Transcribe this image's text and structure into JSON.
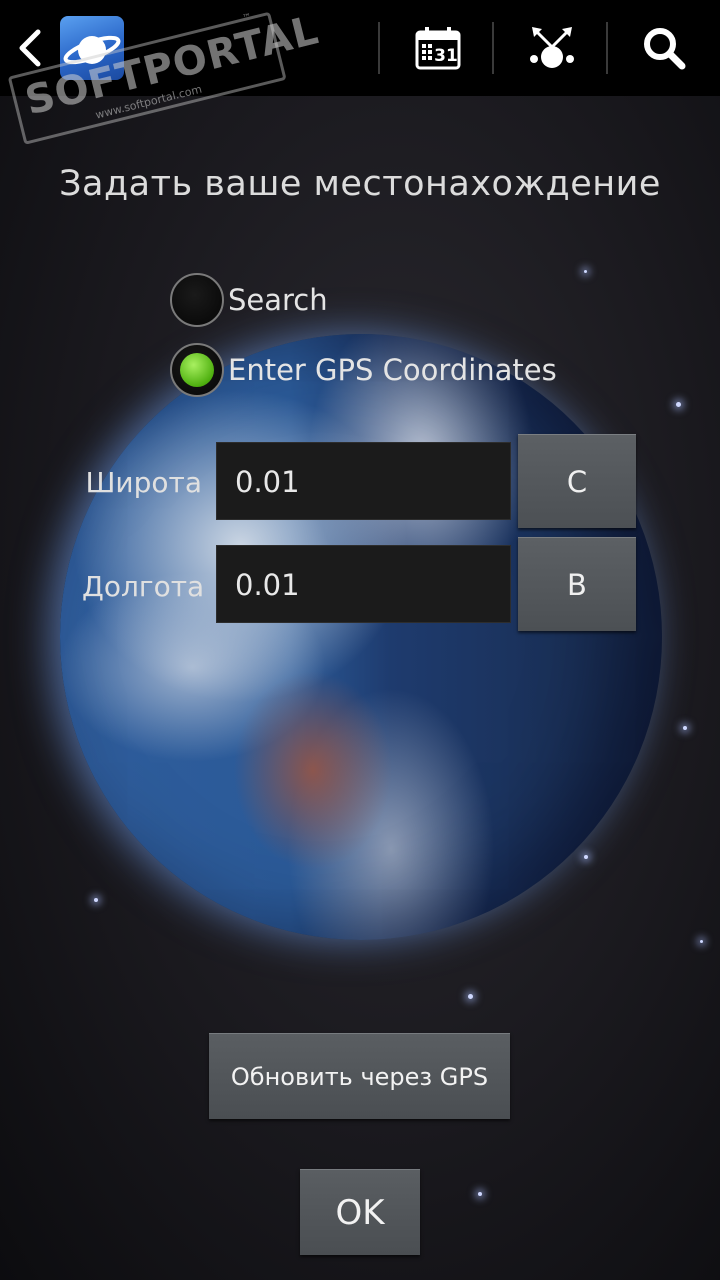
{
  "actionbar": {
    "icons": [
      "back-icon",
      "app-logo-icon",
      "calendar-icon",
      "constellation-icon",
      "search-icon"
    ],
    "calendar_day": "31"
  },
  "watermark": {
    "brand": "SOFTPORTAL",
    "url": "www.softportal.com",
    "tm": "™"
  },
  "dialog": {
    "title": "Задать ваше местонахождение",
    "options": [
      {
        "label": "Search",
        "selected": false
      },
      {
        "label": "Enter GPS Coordinates",
        "selected": true
      }
    ],
    "latitude": {
      "label": "Широта",
      "value": "0.01",
      "hemisphere": "C"
    },
    "longitude": {
      "label": "Долгота",
      "value": "0.01",
      "hemisphere": "B"
    },
    "gps_button": "Обновить через GPS",
    "ok_button": "OK"
  },
  "colors": {
    "actionbar_bg": "#000000",
    "radio_selected": "#6ad02a",
    "button_bg": "#52565a"
  }
}
